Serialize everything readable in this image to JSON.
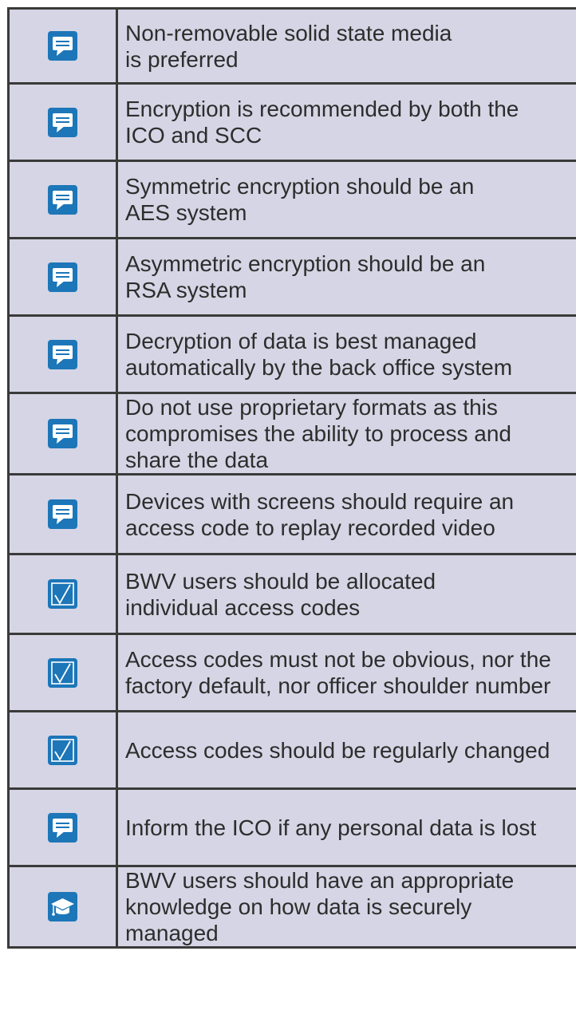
{
  "colors": {
    "row_background": "#d5d5e5",
    "border": "#3a3a3a",
    "icon_background": "#1c76b8",
    "text": "#2d2d2d"
  },
  "rows": [
    {
      "icon": "speech-bubble-icon",
      "text": "Non-removable solid state media\nis preferred"
    },
    {
      "icon": "speech-bubble-icon",
      "text": "Encryption is recommended by both the\nICO and SCC"
    },
    {
      "icon": "speech-bubble-icon",
      "text": "Symmetric encryption should be an\nAES system"
    },
    {
      "icon": "speech-bubble-icon",
      "text": "Asymmetric encryption should be an\nRSA system"
    },
    {
      "icon": "speech-bubble-icon",
      "text": "Decryption of data is best managed\nautomatically by the back office system"
    },
    {
      "icon": "speech-bubble-icon",
      "text": "Do not use proprietary formats as this\ncompromises the ability to process and\nshare the data"
    },
    {
      "icon": "speech-bubble-icon",
      "text": "Devices with screens should require an\naccess code to replay recorded video"
    },
    {
      "icon": "checkbox-icon",
      "text": "BWV users should be allocated\nindividual access codes"
    },
    {
      "icon": "checkbox-icon",
      "text": "Access codes must not be obvious, nor the\nfactory default, nor officer shoulder number"
    },
    {
      "icon": "checkbox-icon",
      "text": "Access codes should be regularly changed"
    },
    {
      "icon": "speech-bubble-icon",
      "text": "Inform the ICO if any personal data is lost"
    },
    {
      "icon": "graduation-cap-icon",
      "text": "BWV users should have an appropriate\nknowledge on how data is securely\nmanaged"
    }
  ]
}
